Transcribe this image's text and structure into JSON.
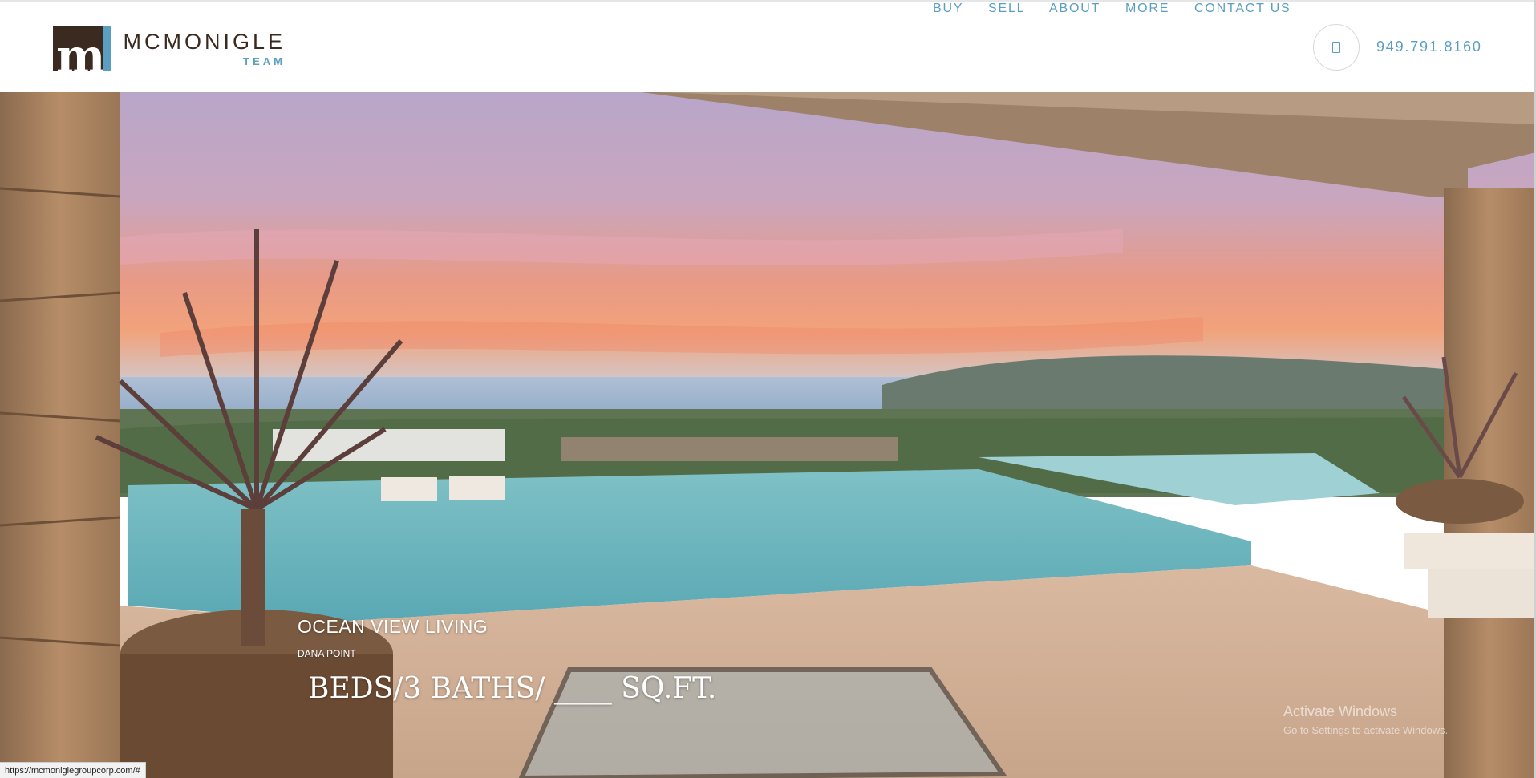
{
  "header": {
    "logo": {
      "mark_letter": "m",
      "name": "MCMONIGLE",
      "sub": "TEAM"
    },
    "nav": [
      {
        "label": "BUY",
        "icon": ""
      },
      {
        "label": "SELL",
        "icon": ""
      },
      {
        "label": "ABOUT",
        "icon": ""
      },
      {
        "label": "MORE",
        "icon": ""
      },
      {
        "label": "CONTACT US",
        "icon": ""
      }
    ],
    "phone_icon": "phone-icon",
    "phone_number": "949.791.8160"
  },
  "hero": {
    "title": "OCEAN VIEW LIVING",
    "location": "DANA POINT",
    "stats": "BEDS/3  BATHS/ ____ SQ.FT."
  },
  "system": {
    "activate_title": "Activate Windows",
    "activate_sub": "Go to Settings to activate Windows.",
    "status_url": "https://mcmoniglegroupcorp.com/#"
  },
  "colors": {
    "brand_brown": "#3b2a1f",
    "brand_blue": "#5a9fc2"
  }
}
